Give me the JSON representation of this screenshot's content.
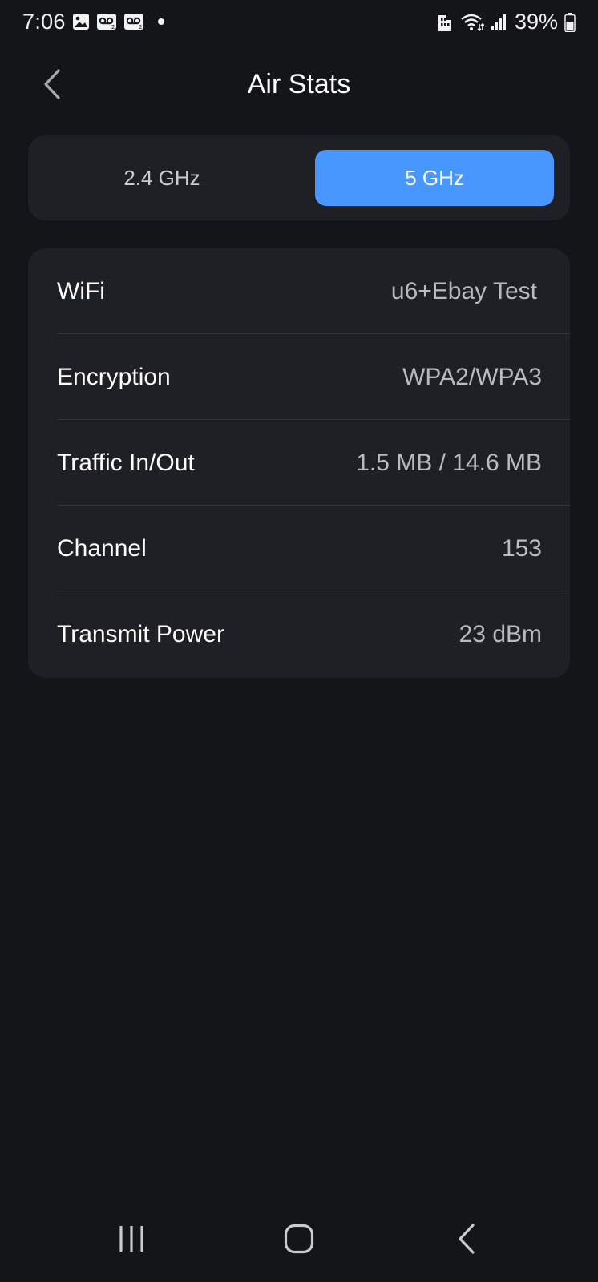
{
  "status_bar": {
    "time": "7:06",
    "battery_percent": "39%",
    "notification_icons": [
      "image-icon",
      "voicemail-icon",
      "voicemail-icon",
      "dot-icon"
    ],
    "system_icons": [
      "work-profile-icon",
      "wifi-icon",
      "signal-icon",
      "battery-icon"
    ]
  },
  "header": {
    "title": "Air Stats",
    "back_icon": "chevron-left-icon"
  },
  "band_switch": {
    "options": [
      {
        "label": "2.4 GHz",
        "selected": false
      },
      {
        "label": "5 GHz",
        "selected": true
      }
    ]
  },
  "stats": [
    {
      "label": "WiFi",
      "value": "u6+Ebay Test"
    },
    {
      "label": "Encryption",
      "value": "WPA2/WPA3"
    },
    {
      "label": "Traffic In/Out",
      "value": "1.5 MB / 14.6 MB"
    },
    {
      "label": "Channel",
      "value": "153"
    },
    {
      "label": "Transmit Power",
      "value": "23 dBm"
    }
  ],
  "nav_bar": {
    "buttons": [
      "recents-icon",
      "home-icon",
      "back-icon"
    ]
  },
  "colors": {
    "background": "#141518",
    "card": "#1f2025",
    "accent": "#4797ff",
    "value_text": "#b9bbc1"
  }
}
